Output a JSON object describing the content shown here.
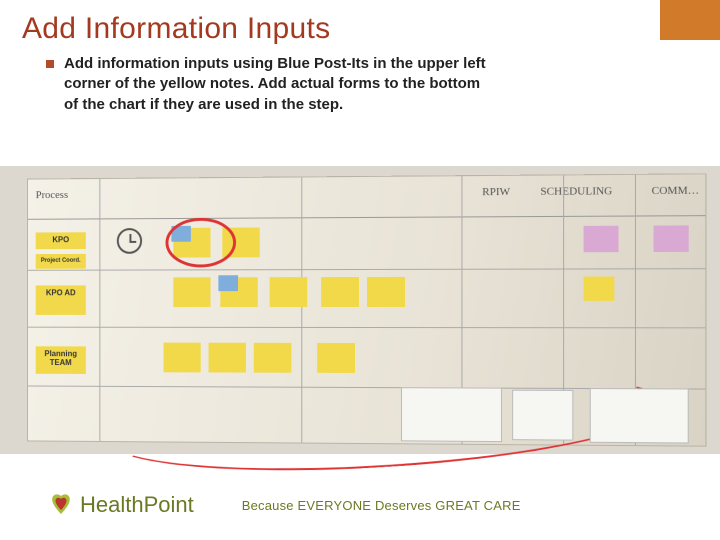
{
  "slide": {
    "title": "Add Information Inputs",
    "bullet": "Add information inputs using Blue Post-Its in the upper left corner of the yellow notes.  Add actual forms to the bottom of the chart if they are used in the step."
  },
  "board": {
    "header_left": "Process",
    "header_right1": "RPIW",
    "header_right2": "SCHEDULING",
    "header_right3": "COMM…",
    "row_labels": [
      "KPO",
      "KPO AD",
      "Planning TEAM"
    ],
    "row_sub": "Project Coord."
  },
  "footer": {
    "logo_main": "Health",
    "logo_sub": "Point",
    "tagline": "Because EVERYONE Deserves GREAT CARE"
  }
}
